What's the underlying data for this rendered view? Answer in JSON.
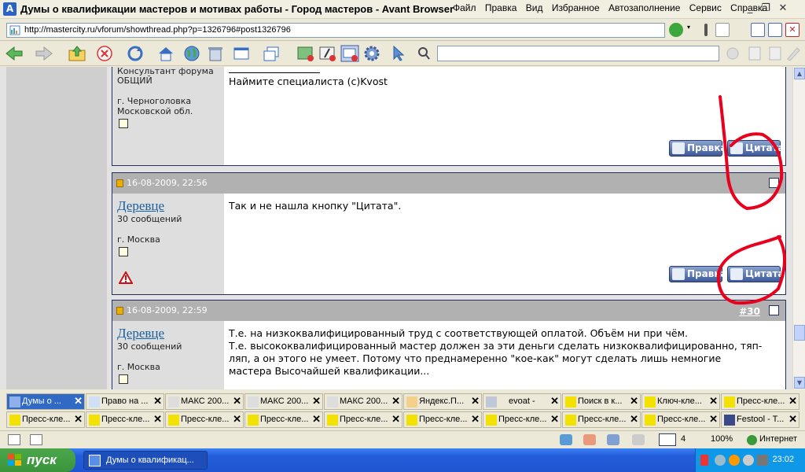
{
  "window": {
    "title": "Думы о квалификации мастеров и мотивах работы - Город мастеров - Avant Browser",
    "menu": [
      "Файл",
      "Правка",
      "Вид",
      "Избранное",
      "Автозаполнение",
      "Сервис",
      "Справка"
    ]
  },
  "address": {
    "url": "http://mastercity.ru/vforum/showthread.php?p=1326796#post1326796"
  },
  "search": {
    "value": ""
  },
  "posts": [
    {
      "user_title": "Консультант форума",
      "user_group": "ОБЩИЙ",
      "location_line1": "г. Черноголовка",
      "location_line2": "Московской обл.",
      "message": "Наймите специалиста (c)Kvost",
      "edit_label": "Правка",
      "quote_label": "Цитата"
    },
    {
      "date": "16-08-2009, 22:56",
      "username": "Деревце",
      "post_count": "30 сообщений",
      "location": "г. Москва",
      "message": "Так и не нашла кнопку \"Цитата\".",
      "edit_label": "Правка",
      "quote_label": "Цитата"
    },
    {
      "date": "16-08-2009, 22:59",
      "number": "#30",
      "username": "Деревце",
      "post_count": "30 сообщений",
      "location": "г. Москва",
      "message_line1": "Т.е. на низкоквалифицированный труд с соответствующей оплатой. Объём ни при чём.",
      "message_line2": "Т.е. высококвалифицированный мастер должен за эти деньги сделать низкоквалифицированно, тяп-",
      "message_line3": "ляп, а он этого не умеет. Потому что преднамеренно \"кое-как\" могут сделать лишь немногие",
      "message_line4": "мастера Высочайшей квалификации..."
    }
  ],
  "tabs_row1": [
    "Думы о ...",
    "Право на ...",
    "МАКС 200...",
    "МАКС 200...",
    "МАКС 200...",
    "Яндекс.П...",
    "evoat -",
    "Поиск в к...",
    "Ключ-кле...",
    "Пресс-кле..."
  ],
  "tabs_row2": [
    "Пресс-кле...",
    "Пресс-кле...",
    "Пресс-кле...",
    "Пресс-кле...",
    "Пресс-кле...",
    "Пресс-кле...",
    "Пресс-кле...",
    "Пресс-кле...",
    "Пресс-кле...",
    "Festool - T..."
  ],
  "status": {
    "tab_count": "4",
    "zoom": "100%",
    "zone": "Интернет"
  },
  "taskbar": {
    "start_label": "пуск",
    "task_label": "Думы о квалификац...",
    "clock": "23:02"
  },
  "colors": {
    "annotation": "#e8001c",
    "link": "#1a5fa0",
    "post_border": "#24315e"
  }
}
